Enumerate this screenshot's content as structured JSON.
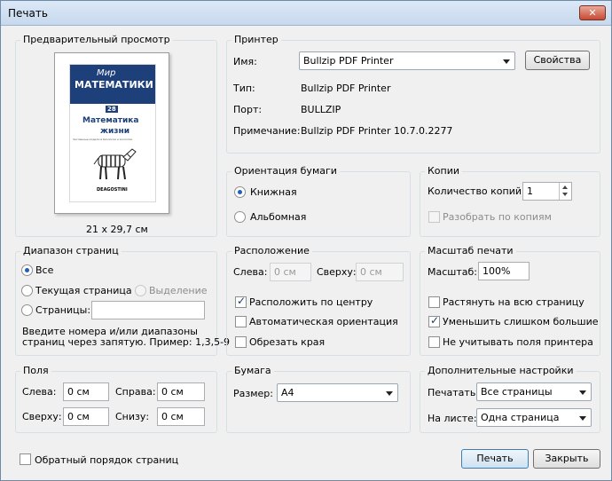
{
  "window": {
    "title": "Печать",
    "close_glyph": "✕"
  },
  "preview": {
    "legend": "Предварительный просмотр",
    "size_text": "21 x 29,7 см",
    "cover": {
      "series": "Мир",
      "brand": "МАТЕМАТИКИ",
      "volume": "28",
      "book_title_line1": "Математика",
      "book_title_line2": "жизни",
      "subtitle": "Численные модели в биологии и экологии",
      "publisher": "DEAGOSTINI"
    }
  },
  "printer": {
    "legend": "Принтер",
    "name_label": "Имя:",
    "name_value": "Bullzip PDF Printer",
    "properties_button": "Свойства",
    "type_label": "Тип:",
    "type_value": "Bullzip PDF Printer",
    "port_label": "Порт:",
    "port_value": "BULLZIP",
    "note_label": "Примечание:",
    "note_value": "Bullzip PDF Printer 10.7.0.2277"
  },
  "orientation": {
    "legend": "Ориентация бумаги",
    "portrait": "Книжная",
    "landscape": "Альбомная",
    "selected": "portrait"
  },
  "copies": {
    "legend": "Копии",
    "count_label": "Количество копий:",
    "count_value": "1",
    "collate_label": "Разобрать по копиям"
  },
  "page_range": {
    "legend": "Диапазон страниц",
    "all": "Все",
    "current": "Текущая страница",
    "selection": "Выделение",
    "pages": "Страницы:",
    "pages_value": "",
    "hint_line1": "Введите номера и/или диапазоны",
    "hint_line2": "страниц через запятую. Пример: 1,3,5-9"
  },
  "layout": {
    "legend": "Расположение",
    "left_label": "Слева:",
    "left_value": "0 см",
    "top_label": "Сверху:",
    "top_value": "0 см",
    "center_label": "Расположить по центру",
    "auto_orient_label": "Автоматическая ориентация",
    "crop_label": "Обрезать края"
  },
  "scale": {
    "legend": "Масштаб печати",
    "scale_label": "Масштаб:",
    "scale_value": "100%",
    "stretch_label": "Растянуть на всю страницу",
    "shrink_label": "Уменьшить слишком большие",
    "ignore_margins_label": "Не учитывать поля принтера"
  },
  "margins": {
    "legend": "Поля",
    "left_label": "Слева:",
    "left_value": "0 см",
    "right_label": "Справа:",
    "right_value": "0 см",
    "top_label": "Сверху:",
    "top_value": "0 см",
    "bottom_label": "Снизу:",
    "bottom_value": "0 см"
  },
  "paper": {
    "legend": "Бумага",
    "size_label": "Размер:",
    "size_value": "A4"
  },
  "extra": {
    "legend": "Дополнительные настройки",
    "print_label": "Печатать:",
    "print_value": "Все страницы",
    "per_sheet_label": "На листе:",
    "per_sheet_value": "Одна страница"
  },
  "footer": {
    "reverse_label": "Обратный порядок страниц",
    "print_button": "Печать",
    "close_button": "Закрыть"
  }
}
